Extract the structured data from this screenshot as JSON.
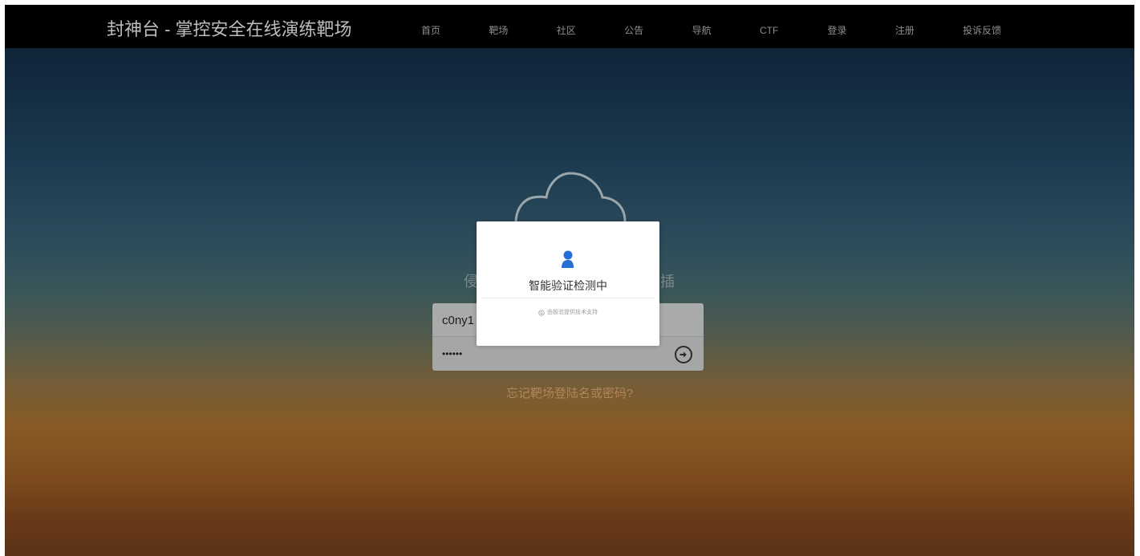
{
  "header": {
    "title": "封神台 - 掌控安全在线演练靶场",
    "nav": [
      {
        "label": "首页"
      },
      {
        "label": "靶场"
      },
      {
        "label": "社区"
      },
      {
        "label": "公告"
      },
      {
        "label": "导航"
      },
      {
        "label": "CTF"
      },
      {
        "label": "登录"
      },
      {
        "label": "注册"
      },
      {
        "label": "投诉反馈"
      }
    ]
  },
  "login": {
    "heading_left": "侵",
    "heading_right": "插",
    "username": "c0ny1",
    "password": "••••••",
    "forgot": "忘记靶场登陆名或密码?"
  },
  "modal": {
    "title": "智能验证检测中",
    "powered_by": "由极验提供技术支持"
  },
  "icons": {
    "cloud": "cloud-icon",
    "submit": "arrow-right-circle-icon",
    "verify": "person-icon",
    "vendor": "geetest-logo-icon"
  },
  "colors": {
    "nav_background": "#000000",
    "verify_accent": "#2470d7",
    "forgot_link": "#b1865a"
  }
}
